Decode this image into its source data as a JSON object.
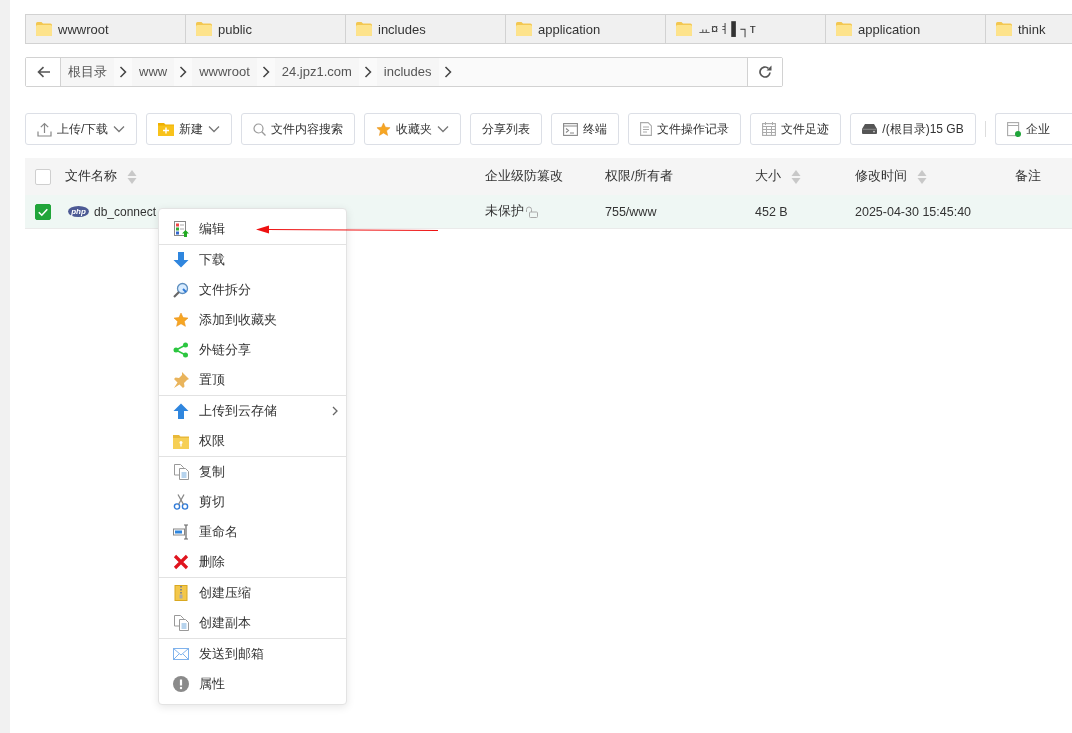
{
  "folder_tabs": [
    {
      "label": "wwwroot"
    },
    {
      "label": "public"
    },
    {
      "label": "includes"
    },
    {
      "label": "application"
    },
    {
      "label": "ㅛ¤ㅕ▌┐т"
    },
    {
      "label": "application"
    },
    {
      "label": "think"
    }
  ],
  "breadcrumb": {
    "path": [
      "根目录",
      "www",
      "wwwroot",
      "24.jpz1.com",
      "includes"
    ]
  },
  "toolbar": {
    "groups": [
      {
        "buttons": [
          {
            "label": "上传/下载",
            "dropdown": true
          },
          {
            "label": "新建",
            "dropdown": true
          },
          {
            "label": "文件内容搜索",
            "dropdown": false
          },
          {
            "label": "收藏夹",
            "dropdown": true
          },
          {
            "label": "分享列表",
            "dropdown": false
          },
          {
            "label": "终端",
            "dropdown": false
          },
          {
            "label": "文件操作记录",
            "dropdown": false
          },
          {
            "label": "文件足迹",
            "dropdown": false
          },
          {
            "label": "/(根目录)15 GB",
            "dropdown": false
          }
        ]
      },
      {
        "buttons": [
          {
            "label": "企业",
            "dropdown": false
          }
        ]
      }
    ]
  },
  "file_table": {
    "select_all": {
      "checked": false
    },
    "columns": [
      {
        "label": "文件名称",
        "sortable": true
      },
      {
        "label": "企业级防篡改",
        "sortable": false
      },
      {
        "label": "权限/所有者",
        "sortable": false
      },
      {
        "label": "大小",
        "sortable": true
      },
      {
        "label": "修改时间",
        "sortable": true
      },
      {
        "label": "备注",
        "sortable": false
      }
    ],
    "rows": [
      {
        "checked": true,
        "type_badge": "php",
        "name": "db_connect",
        "protection": "未保护",
        "permission": "755/www",
        "size": "452 B",
        "modified": "2025-04-30 15:45:40"
      }
    ]
  },
  "context_menu": {
    "groups": [
      {
        "items": [
          {
            "label": "编辑",
            "submenu": false
          }
        ]
      },
      {
        "items": [
          {
            "label": "下载",
            "submenu": false
          },
          {
            "label": "文件拆分",
            "submenu": false
          },
          {
            "label": "添加到收藏夹",
            "submenu": false
          },
          {
            "label": "外链分享",
            "submenu": false
          },
          {
            "label": "置顶",
            "submenu": false
          }
        ]
      },
      {
        "items": [
          {
            "label": "上传到云存储",
            "submenu": true
          },
          {
            "label": "权限",
            "submenu": false
          }
        ]
      },
      {
        "items": [
          {
            "label": "复制",
            "submenu": false
          },
          {
            "label": "剪切",
            "submenu": false
          },
          {
            "label": "重命名",
            "submenu": false
          },
          {
            "label": "删除",
            "submenu": false
          }
        ]
      },
      {
        "items": [
          {
            "label": "创建压缩",
            "submenu": false
          },
          {
            "label": "创建副本",
            "submenu": false
          }
        ]
      },
      {
        "items": [
          {
            "label": "发送到邮箱",
            "submenu": false
          },
          {
            "label": "属性",
            "submenu": false
          }
        ]
      }
    ]
  }
}
